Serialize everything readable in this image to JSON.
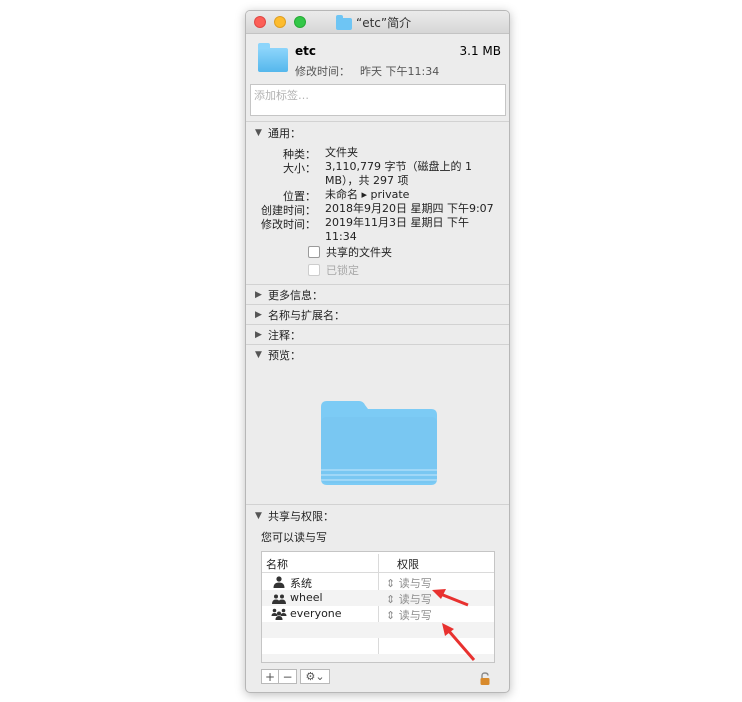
{
  "window": {
    "title": "“etc”简介"
  },
  "header": {
    "name": "etc",
    "size": "3.1 MB",
    "modified_label": "修改时间：",
    "modified_value": "昨天 下午11:34"
  },
  "tags": {
    "placeholder": "添加标签…"
  },
  "general": {
    "heading": "通用：",
    "rows": [
      {
        "key": "种类：",
        "value": "文件夹"
      },
      {
        "key": "大小：",
        "value": "3,110,779 字节（磁盘上的 1 MB），共 297 项"
      },
      {
        "key": "位置：",
        "value": "未命名 ▸ private"
      },
      {
        "key": "创建时间：",
        "value": "2018年9月20日 星期四 下午9:07"
      },
      {
        "key": "修改时间：",
        "value": "2019年11月3日 星期日 下午11:34"
      }
    ],
    "shared_folder": "共享的文件夹",
    "locked": "已锁定"
  },
  "sections": {
    "more_info": "更多信息：",
    "name_ext": "名称与扩展名：",
    "comments": "注释：",
    "preview": "预览：",
    "sharing": "共享与权限："
  },
  "permissions": {
    "summary": "您可以读与写",
    "col_name": "名称",
    "col_priv": "权限",
    "rows": [
      {
        "name": "系统",
        "priv": "读与写",
        "icon": "single-user-icon"
      },
      {
        "name": "wheel",
        "priv": "读与写",
        "icon": "group-icon"
      },
      {
        "name": "everyone",
        "priv": "读与写",
        "icon": "everyone-icon"
      }
    ]
  },
  "toolbar": {
    "add": "+",
    "remove": "−",
    "gear": "⚙︎⌄"
  },
  "colors": {
    "folder": "#6ec5f4",
    "annotation_arrow": "#e8312f"
  }
}
